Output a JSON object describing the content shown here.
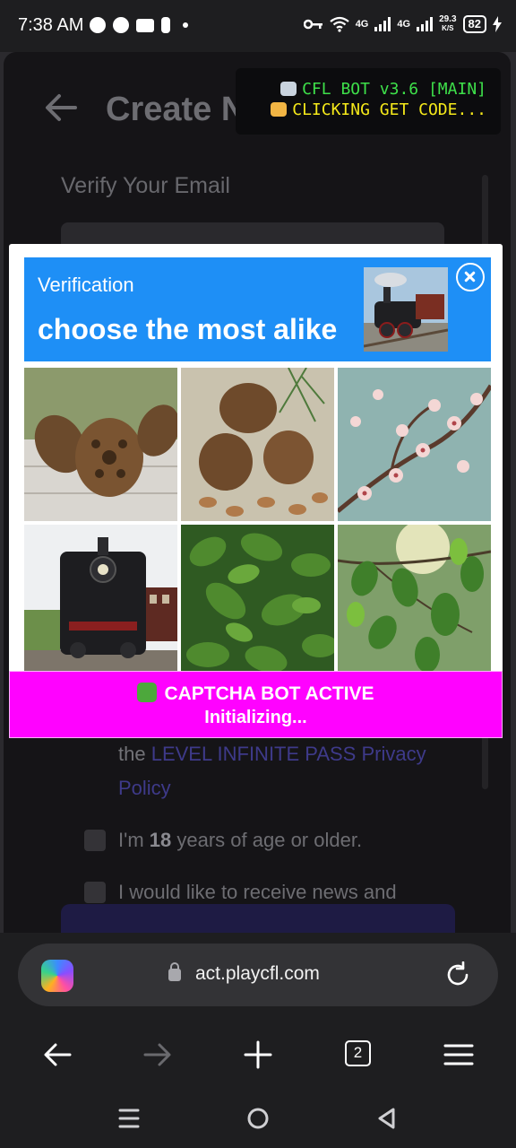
{
  "status_bar": {
    "time": "7:38 AM",
    "net_speed_top": "29.3",
    "net_speed_unit": "K/S",
    "network_1": "4G",
    "network_2": "4G",
    "battery": "82"
  },
  "page": {
    "title": "Create New",
    "verify_label": "Verify Your Email",
    "privacy_prefix": "the",
    "privacy_link": "LEVEL INFINITE PASS Privacy Policy",
    "age_label_prefix": "I'm",
    "age_value": "18",
    "age_label_suffix": "years of age or older.",
    "news_label": "I would like to receive news and"
  },
  "bot_banner": {
    "line1": "CFL BOT v3.6 [MAIN]",
    "line2": "CLICKING GET CODE..."
  },
  "captcha": {
    "heading": "Verification",
    "instruction": "choose the most alike",
    "sample_image": "steam-locomotive",
    "tiles": [
      {
        "subject": "pine-cones-on-wood"
      },
      {
        "subject": "pine-cones-with-almonds"
      },
      {
        "subject": "cherry-blossom-branch"
      },
      {
        "subject": "steam-locomotive"
      },
      {
        "subject": "green-leaves"
      },
      {
        "subject": "leaves-in-sunlight"
      }
    ]
  },
  "captcha_bot": {
    "line1": "CAPTCHA BOT ACTIVE",
    "line2": "Initializing..."
  },
  "browser": {
    "url": "act.playcfl.com",
    "tab_count": "2"
  },
  "colors": {
    "captcha_header": "#1e8ff6",
    "bot_strip": "#ff02ff",
    "bot_green": "#3ee04a",
    "bot_yellow": "#f5e91a",
    "link": "#3e3a8a"
  }
}
